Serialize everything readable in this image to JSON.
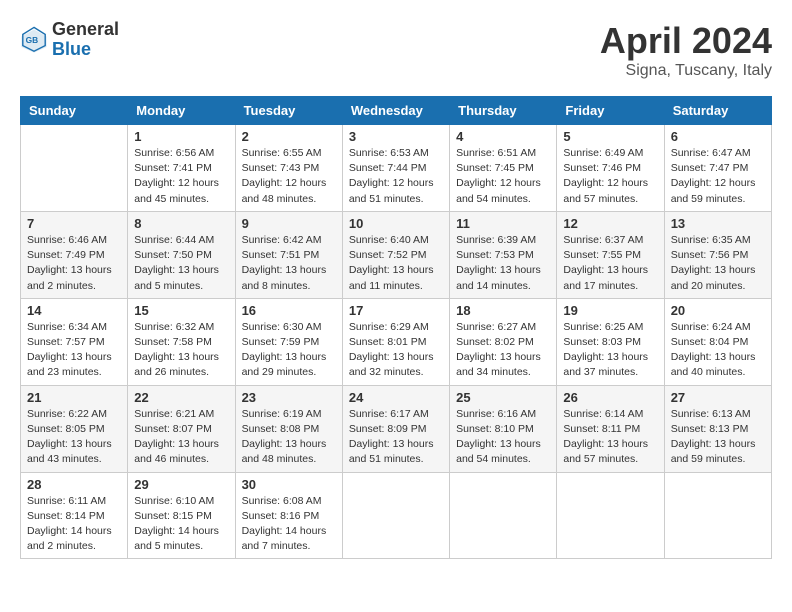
{
  "header": {
    "logo_general": "General",
    "logo_blue": "Blue",
    "month_year": "April 2024",
    "location": "Signa, Tuscany, Italy"
  },
  "days_of_week": [
    "Sunday",
    "Monday",
    "Tuesday",
    "Wednesday",
    "Thursday",
    "Friday",
    "Saturday"
  ],
  "weeks": [
    [
      {
        "day": "",
        "info": ""
      },
      {
        "day": "1",
        "info": "Sunrise: 6:56 AM\nSunset: 7:41 PM\nDaylight: 12 hours\nand 45 minutes."
      },
      {
        "day": "2",
        "info": "Sunrise: 6:55 AM\nSunset: 7:43 PM\nDaylight: 12 hours\nand 48 minutes."
      },
      {
        "day": "3",
        "info": "Sunrise: 6:53 AM\nSunset: 7:44 PM\nDaylight: 12 hours\nand 51 minutes."
      },
      {
        "day": "4",
        "info": "Sunrise: 6:51 AM\nSunset: 7:45 PM\nDaylight: 12 hours\nand 54 minutes."
      },
      {
        "day": "5",
        "info": "Sunrise: 6:49 AM\nSunset: 7:46 PM\nDaylight: 12 hours\nand 57 minutes."
      },
      {
        "day": "6",
        "info": "Sunrise: 6:47 AM\nSunset: 7:47 PM\nDaylight: 12 hours\nand 59 minutes."
      }
    ],
    [
      {
        "day": "7",
        "info": "Sunrise: 6:46 AM\nSunset: 7:49 PM\nDaylight: 13 hours\nand 2 minutes."
      },
      {
        "day": "8",
        "info": "Sunrise: 6:44 AM\nSunset: 7:50 PM\nDaylight: 13 hours\nand 5 minutes."
      },
      {
        "day": "9",
        "info": "Sunrise: 6:42 AM\nSunset: 7:51 PM\nDaylight: 13 hours\nand 8 minutes."
      },
      {
        "day": "10",
        "info": "Sunrise: 6:40 AM\nSunset: 7:52 PM\nDaylight: 13 hours\nand 11 minutes."
      },
      {
        "day": "11",
        "info": "Sunrise: 6:39 AM\nSunset: 7:53 PM\nDaylight: 13 hours\nand 14 minutes."
      },
      {
        "day": "12",
        "info": "Sunrise: 6:37 AM\nSunset: 7:55 PM\nDaylight: 13 hours\nand 17 minutes."
      },
      {
        "day": "13",
        "info": "Sunrise: 6:35 AM\nSunset: 7:56 PM\nDaylight: 13 hours\nand 20 minutes."
      }
    ],
    [
      {
        "day": "14",
        "info": "Sunrise: 6:34 AM\nSunset: 7:57 PM\nDaylight: 13 hours\nand 23 minutes."
      },
      {
        "day": "15",
        "info": "Sunrise: 6:32 AM\nSunset: 7:58 PM\nDaylight: 13 hours\nand 26 minutes."
      },
      {
        "day": "16",
        "info": "Sunrise: 6:30 AM\nSunset: 7:59 PM\nDaylight: 13 hours\nand 29 minutes."
      },
      {
        "day": "17",
        "info": "Sunrise: 6:29 AM\nSunset: 8:01 PM\nDaylight: 13 hours\nand 32 minutes."
      },
      {
        "day": "18",
        "info": "Sunrise: 6:27 AM\nSunset: 8:02 PM\nDaylight: 13 hours\nand 34 minutes."
      },
      {
        "day": "19",
        "info": "Sunrise: 6:25 AM\nSunset: 8:03 PM\nDaylight: 13 hours\nand 37 minutes."
      },
      {
        "day": "20",
        "info": "Sunrise: 6:24 AM\nSunset: 8:04 PM\nDaylight: 13 hours\nand 40 minutes."
      }
    ],
    [
      {
        "day": "21",
        "info": "Sunrise: 6:22 AM\nSunset: 8:05 PM\nDaylight: 13 hours\nand 43 minutes."
      },
      {
        "day": "22",
        "info": "Sunrise: 6:21 AM\nSunset: 8:07 PM\nDaylight: 13 hours\nand 46 minutes."
      },
      {
        "day": "23",
        "info": "Sunrise: 6:19 AM\nSunset: 8:08 PM\nDaylight: 13 hours\nand 48 minutes."
      },
      {
        "day": "24",
        "info": "Sunrise: 6:17 AM\nSunset: 8:09 PM\nDaylight: 13 hours\nand 51 minutes."
      },
      {
        "day": "25",
        "info": "Sunrise: 6:16 AM\nSunset: 8:10 PM\nDaylight: 13 hours\nand 54 minutes."
      },
      {
        "day": "26",
        "info": "Sunrise: 6:14 AM\nSunset: 8:11 PM\nDaylight: 13 hours\nand 57 minutes."
      },
      {
        "day": "27",
        "info": "Sunrise: 6:13 AM\nSunset: 8:13 PM\nDaylight: 13 hours\nand 59 minutes."
      }
    ],
    [
      {
        "day": "28",
        "info": "Sunrise: 6:11 AM\nSunset: 8:14 PM\nDaylight: 14 hours\nand 2 minutes."
      },
      {
        "day": "29",
        "info": "Sunrise: 6:10 AM\nSunset: 8:15 PM\nDaylight: 14 hours\nand 5 minutes."
      },
      {
        "day": "30",
        "info": "Sunrise: 6:08 AM\nSunset: 8:16 PM\nDaylight: 14 hours\nand 7 minutes."
      },
      {
        "day": "",
        "info": ""
      },
      {
        "day": "",
        "info": ""
      },
      {
        "day": "",
        "info": ""
      },
      {
        "day": "",
        "info": ""
      }
    ]
  ]
}
